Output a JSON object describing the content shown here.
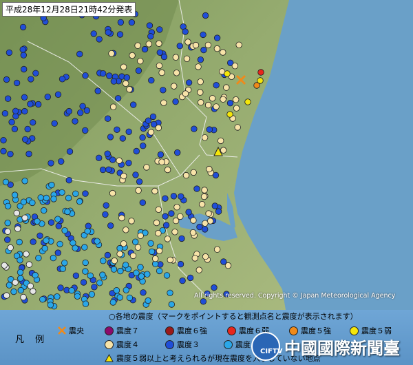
{
  "header": {
    "timestamp": "平成28年12月28日21時42分発表"
  },
  "map": {
    "copyright": "All rights reserved. Copyright © Japan Meteorological Agency",
    "colors": {
      "shindo7": "#8b0a6b",
      "shindo6_strong": "#9a1a1a",
      "shindo6_weak": "#e8261c",
      "shindo5_strong": "#f08a1a",
      "shindo5_weak": "#f5e60a",
      "shindo4": "#f7e3a8",
      "shindo3": "#1f4ed8",
      "shindo2": "#2aa7e8",
      "shindo1": "#e6e6e6",
      "sea": "#6aa0c8",
      "land": "#8aa36a"
    }
  },
  "legend": {
    "title": "凡 例",
    "note": "○各地の震度（マークをポイントすると観測点名と震度が表示されます）",
    "items": [
      {
        "label": "震央",
        "icon": "epicenter-cross-icon"
      },
      {
        "label": "震度７",
        "color": "#8b0a6b"
      },
      {
        "label": "震度６強",
        "color": "#9a1a1a"
      },
      {
        "label": "震度６弱",
        "color": "#e8261c"
      },
      {
        "label": "震度５強",
        "color": "#f08a1a"
      },
      {
        "label": "震度５弱",
        "color": "#f5e60a"
      },
      {
        "label": "震度４",
        "color": "#f7e3a8"
      },
      {
        "label": "震度３",
        "color": "#1f4ed8"
      },
      {
        "label": "震度２",
        "color": "#2aa7e8"
      }
    ],
    "triangle_note": "震度５弱以上と考えられるが現在震度を入手していない地点"
  },
  "watermark": {
    "text": "中國國際新聞臺",
    "sub": "CIFTV"
  }
}
